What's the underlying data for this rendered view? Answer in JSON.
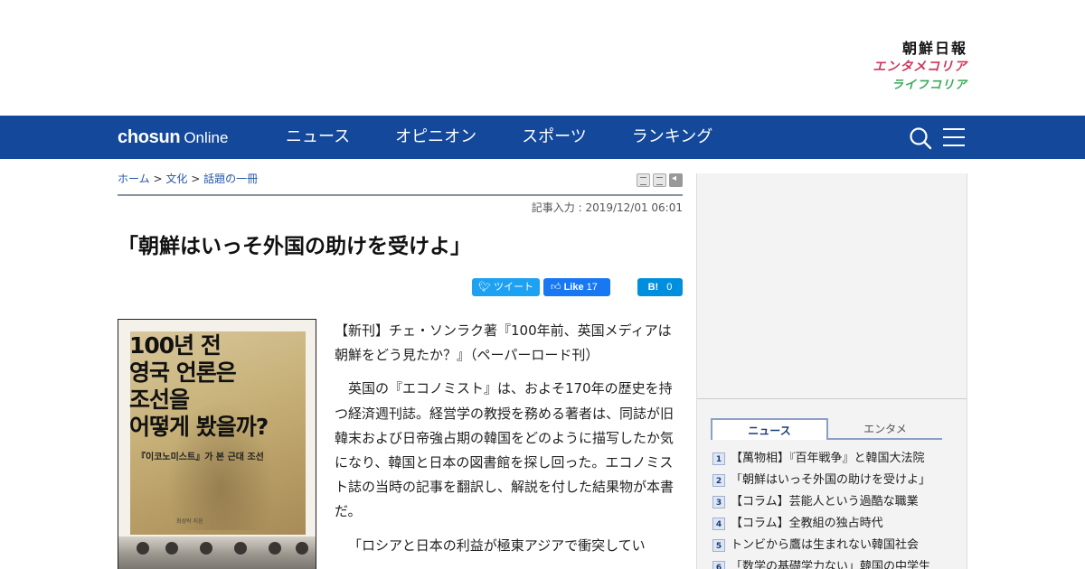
{
  "brands": {
    "main": "朝鮮日報",
    "enta": "エンタメコリア",
    "life": "ライフコリア"
  },
  "nav": {
    "logo_bold": "chosun",
    "logo_light": "Online",
    "items": [
      "ニュース",
      "オピニオン",
      "スポーツ",
      "ランキング"
    ],
    "icons": [
      "search-icon",
      "hamburger-menu-icon"
    ]
  },
  "breadcrumb": {
    "home": "ホーム",
    "sep": ">",
    "category": "文化",
    "subcategory": "話題の一冊"
  },
  "article": {
    "date": "記事入力 : 2019/12/01 06:01",
    "title": "「朝鮮はいっそ外国の助けを受けよ」",
    "share": {
      "tweet": "ツイート",
      "like": "Like",
      "like_count": "17",
      "hatena": "B!",
      "hatena_count": "0"
    },
    "paragraphs": [
      "【新刊】チェ・ソンラク著『100年前、英国メディアは朝鮮をどう見たか？』（ペーパーロード刊）",
      "英国の『エコノミスト』は、およそ170年の歴史を持つ経済週刊誌。経営学の教授を務める著者は、同誌が旧韓末および日帝強占期の韓国をどのように描写したか気になり、韓国と日本の図書館を探し回った。エコノミスト誌の当時の記事を翻訳し、解説を付した結果物が本書だ。",
      "「ロシアと日本の利益が極東アジアで衝突してい"
    ],
    "book": {
      "title": "100년 전\n영국 언론은\n조선을\n어떻게 봤을까?",
      "subtitle": "『이코노미스트』가 본 근대 조선",
      "author": "최성락 지음"
    }
  },
  "sidebar": {
    "tabs": [
      "ニュース",
      "エンタメ"
    ],
    "ranking": [
      {
        "num": "1",
        "text": "【萬物相】『百年戦争』と韓国大法院"
      },
      {
        "num": "2",
        "text": "「朝鮮はいっそ外国の助けを受けよ」"
      },
      {
        "num": "3",
        "text": "【コラム】芸能人という過酷な職業"
      },
      {
        "num": "4",
        "text": "【コラム】全教組の独占時代"
      },
      {
        "num": "5",
        "text": "トンビから鷹は生まれない韓国社会"
      },
      {
        "num": "6",
        "text": "「数学の基礎学力ない」韓国の中学生"
      }
    ]
  }
}
